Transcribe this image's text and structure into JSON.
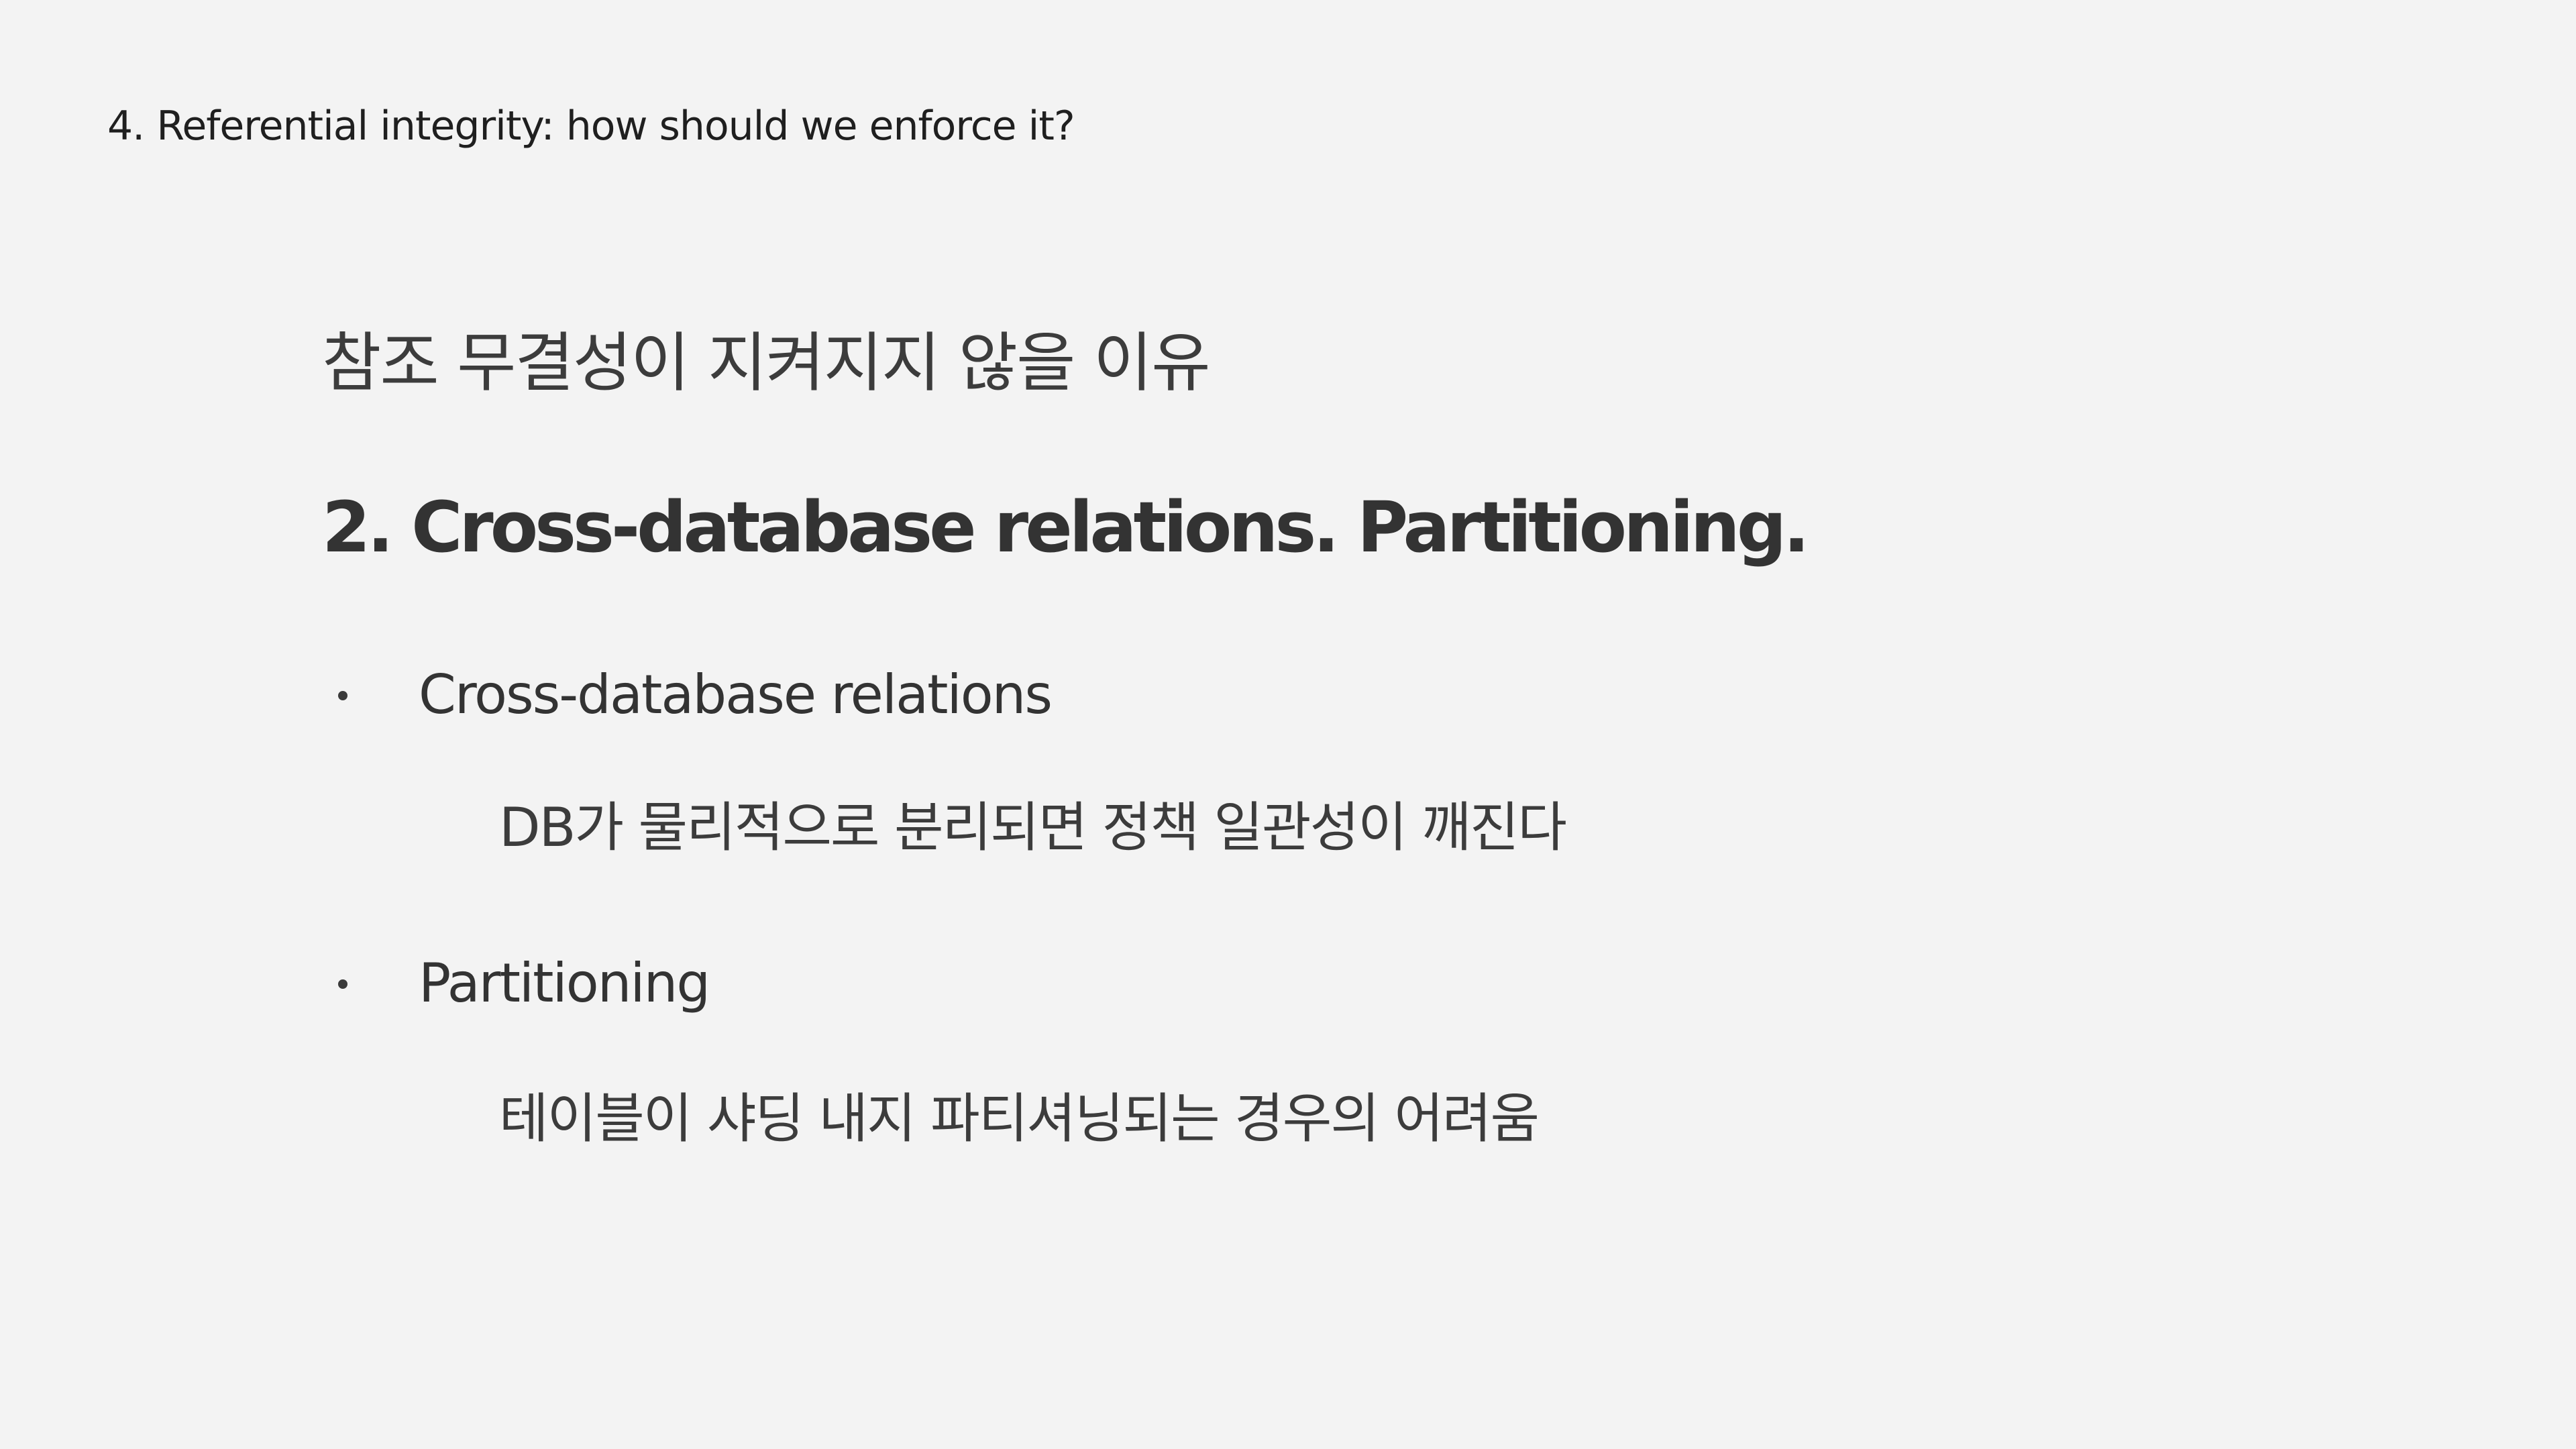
{
  "section_header": "4. Referential integrity: how should we enforce it?",
  "subtitle": "참조 무결성이 지켜지지 않을 이유",
  "heading": "2. Cross-database relations. Partitioning.",
  "bullets": [
    {
      "label": "Cross-database relations",
      "description": "DB가 물리적으로 분리되면 정책 일관성이 깨진다"
    },
    {
      "label": "Partitioning",
      "description": "테이블이 샤딩 내지 파티셔닝되는 경우의 어려움"
    }
  ],
  "colors": {
    "background": "#f3f3f3",
    "text": "#333333"
  }
}
